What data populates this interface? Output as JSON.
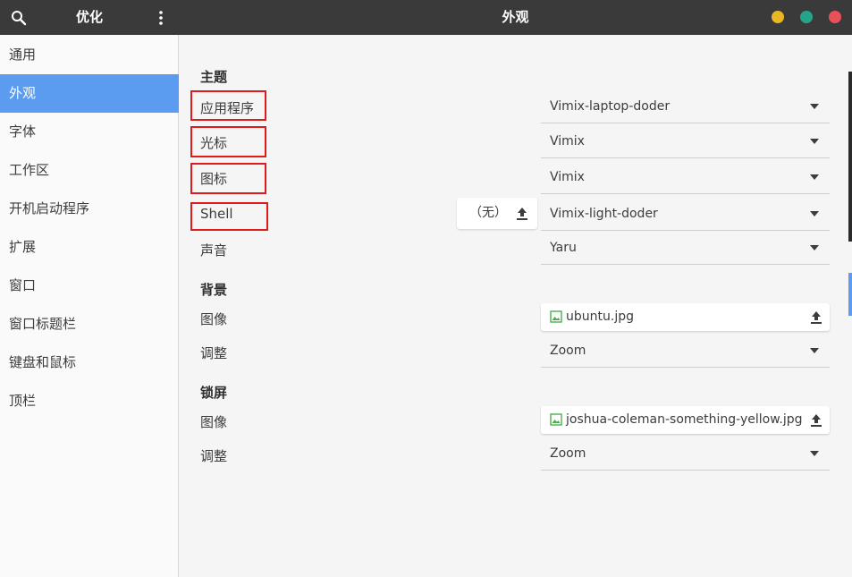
{
  "header": {
    "sidebar_title": "优化",
    "title": "外观",
    "icons": {
      "search": "search-icon",
      "menu": "vertical-dots-icon"
    },
    "window_colors": {
      "minimize": "#e9b625",
      "maximize": "#26a48a",
      "close": "#e8515a"
    }
  },
  "sidebar": {
    "items": [
      {
        "label": "通用"
      },
      {
        "label": "外观",
        "active": true
      },
      {
        "label": "字体"
      },
      {
        "label": "工作区"
      },
      {
        "label": "开机启动程序"
      },
      {
        "label": "扩展"
      },
      {
        "label": "窗口"
      },
      {
        "label": "窗口标题栏"
      },
      {
        "label": "键盘和鼠标"
      },
      {
        "label": "顶栏"
      }
    ]
  },
  "main": {
    "themes": {
      "title": "主题",
      "applications": {
        "label": "应用程序",
        "value": "Vimix-laptop-doder"
      },
      "cursor": {
        "label": "光标",
        "value": "Vimix"
      },
      "icons": {
        "label": "图标",
        "value": "Vimix"
      },
      "shell": {
        "label": "Shell",
        "value": "Vimix-light-doder",
        "file_button": "（无）"
      },
      "sound": {
        "label": "声音",
        "value": "Yaru"
      }
    },
    "background": {
      "title": "背景",
      "image": {
        "label": "图像",
        "file": "ubuntu.jpg"
      },
      "adjust": {
        "label": "调整",
        "value": "Zoom"
      }
    },
    "lockscreen": {
      "title": "锁屏",
      "image": {
        "label": "图像",
        "file": "joshua-coleman-something-yellow.jpg"
      },
      "adjust": {
        "label": "调整",
        "value": "Zoom"
      }
    }
  },
  "accent_color": "#5b9bf0",
  "highlight_box_color": "#e01b1b"
}
